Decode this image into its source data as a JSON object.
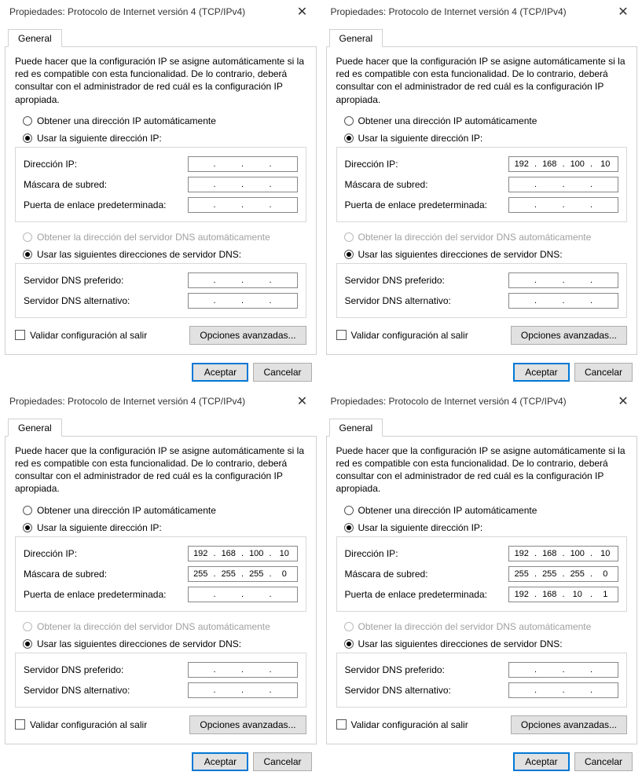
{
  "strings": {
    "title": "Propiedades: Protocolo de Internet versión 4 (TCP/IPv4)",
    "tab_general": "General",
    "desc": "Puede hacer que la configuración IP se asigne automáticamente si la red es compatible con esta funcionalidad. De lo contrario, deberá consultar con el administrador de red cuál es la configuración IP apropiada.",
    "radio_auto_ip": "Obtener una dirección IP automáticamente",
    "radio_manual_ip": "Usar la siguiente dirección IP:",
    "lbl_ip": "Dirección IP:",
    "lbl_mask": "Máscara de subred:",
    "lbl_gateway": "Puerta de enlace predeterminada:",
    "radio_auto_dns": "Obtener la dirección del servidor DNS automáticamente",
    "radio_manual_dns": "Usar las siguientes direcciones de servidor DNS:",
    "lbl_dns1": "Servidor DNS preferido:",
    "lbl_dns2": "Servidor DNS alternativo:",
    "validate": "Validar configuración al salir",
    "advanced": "Opciones avanzadas...",
    "accept": "Aceptar",
    "cancel": "Cancelar",
    "dot": "."
  },
  "dialogs": [
    {
      "ip": [
        "",
        "",
        "",
        ""
      ],
      "mask": [
        "",
        "",
        "",
        ""
      ],
      "gateway": [
        "",
        "",
        "",
        ""
      ],
      "dns1": [
        "",
        "",
        "",
        ""
      ],
      "dns2": [
        "",
        "",
        "",
        ""
      ]
    },
    {
      "ip": [
        "192",
        "168",
        "100",
        "10"
      ],
      "mask": [
        "",
        "",
        "",
        ""
      ],
      "gateway": [
        "",
        "",
        "",
        ""
      ],
      "dns1": [
        "",
        "",
        "",
        ""
      ],
      "dns2": [
        "",
        "",
        "",
        ""
      ]
    },
    {
      "ip": [
        "192",
        "168",
        "100",
        "10"
      ],
      "mask": [
        "255",
        "255",
        "255",
        "0"
      ],
      "gateway": [
        "",
        "",
        "",
        ""
      ],
      "dns1": [
        "",
        "",
        "",
        ""
      ],
      "dns2": [
        "",
        "",
        "",
        ""
      ]
    },
    {
      "ip": [
        "192",
        "168",
        "100",
        "10"
      ],
      "mask": [
        "255",
        "255",
        "255",
        "0"
      ],
      "gateway": [
        "192",
        "168",
        "10",
        "1"
      ],
      "dns1": [
        "",
        "",
        "",
        ""
      ],
      "dns2": [
        "",
        "",
        "",
        ""
      ]
    }
  ]
}
